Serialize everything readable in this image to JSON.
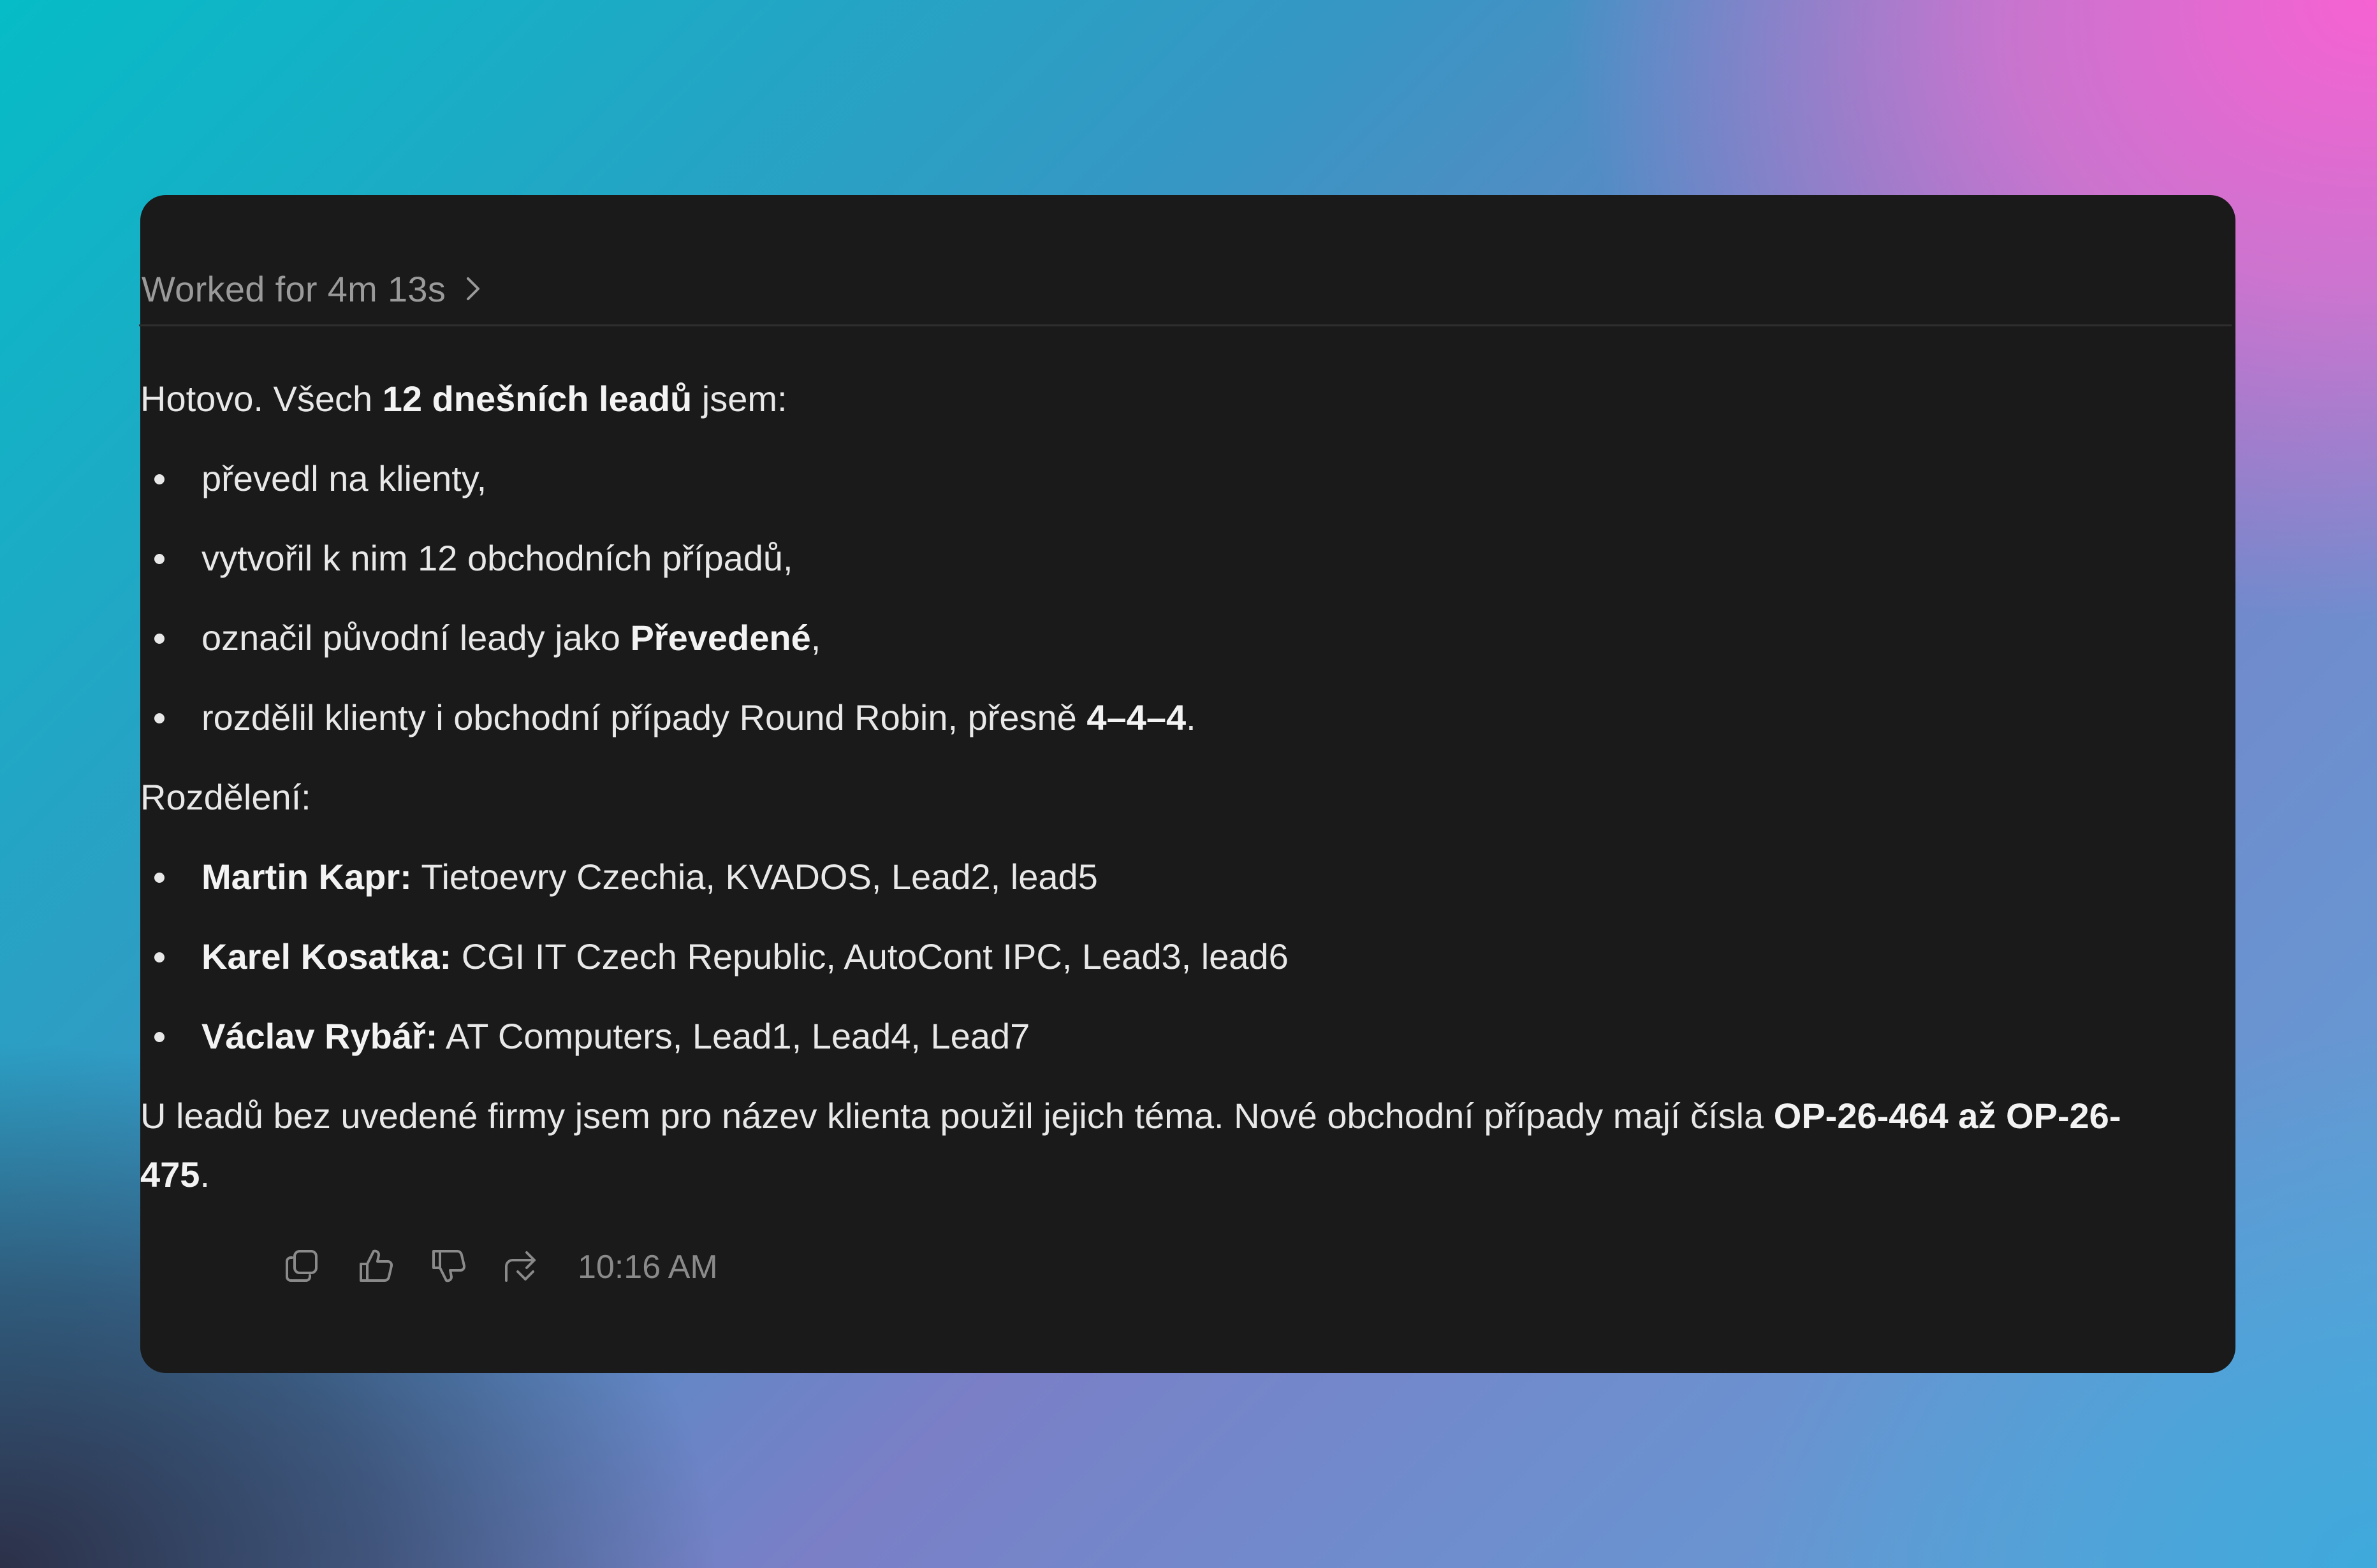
{
  "header": {
    "worked_label": "Worked for 4m 13s"
  },
  "message": {
    "intro_prefix": "Hotovo. Všech ",
    "intro_bold": "12 dnešních leadů",
    "intro_suffix": " jsem:",
    "bullets": [
      {
        "text": "převedl na klienty,"
      },
      {
        "text": "vytvořil k nim 12 obchodních případů,"
      },
      {
        "prefix": "označil původní leady jako ",
        "bold": "Převedené",
        "suffix": ","
      },
      {
        "prefix": "rozdělil klienty i obchodní případy Round Robin, přesně ",
        "bold": "4–4–4",
        "suffix": "."
      }
    ],
    "distribution_label": "Rozdělení:",
    "distribution": [
      {
        "name": "Martin Kapr:",
        "items": " Tietoevry Czechia, KVADOS, Lead2, lead5"
      },
      {
        "name": "Karel Kosatka:",
        "items": " CGI IT Czech Republic, AutoCont IPC, Lead3, lead6"
      },
      {
        "name": "Václav Rybář:",
        "items": " AT Computers, Lead1, Lead4, Lead7"
      }
    ],
    "closing_prefix": "U leadů bez uvedené firmy jsem pro název klienta použil jejich téma. Nové obchodní případy mají čísla ",
    "closing_bold_1": "OP-26-464",
    "closing_mid": " až ",
    "closing_bold_2": "OP-26-475",
    "closing_suffix": "."
  },
  "actions": {
    "icons": [
      "copy-icon",
      "thumbs-up-icon",
      "thumbs-down-icon",
      "share-icon"
    ],
    "timestamp": "10:16 AM"
  },
  "colors": {
    "card_background": "#1a1a1a",
    "text": "#e8e8e8",
    "muted": "#9a9a9a"
  }
}
